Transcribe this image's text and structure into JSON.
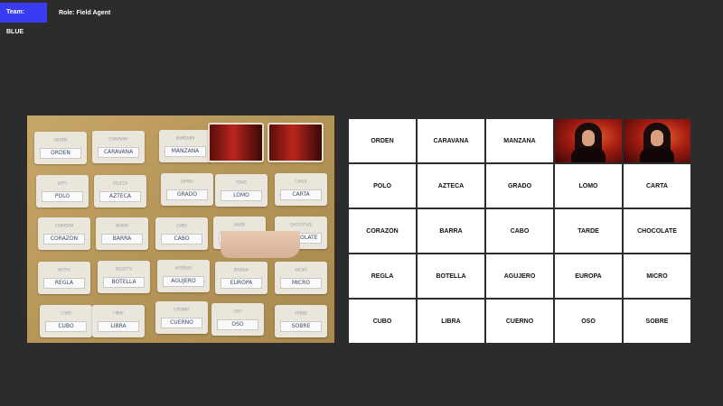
{
  "header": {
    "team": "Team: BLUE",
    "role": "Role: Field Agent"
  },
  "colors": {
    "team_accent": "#3a3af0",
    "agent_card": "#b8261c",
    "background": "#2c2c2c"
  },
  "board": {
    "cards": [
      {
        "word": "ORDEN",
        "revealed": false
      },
      {
        "word": "CARAVANA",
        "revealed": false
      },
      {
        "word": "MANZANA",
        "revealed": false
      },
      {
        "word": "",
        "revealed": true,
        "image": "agent-portrait"
      },
      {
        "word": "",
        "revealed": true,
        "image": "agent-portrait"
      },
      {
        "word": "POLO",
        "revealed": false
      },
      {
        "word": "AZTECA",
        "revealed": false
      },
      {
        "word": "GRADO",
        "revealed": false
      },
      {
        "word": "LOMO",
        "revealed": false
      },
      {
        "word": "CARTA",
        "revealed": false
      },
      {
        "word": "CORAZON",
        "revealed": false
      },
      {
        "word": "BARRA",
        "revealed": false
      },
      {
        "word": "CABO",
        "revealed": false
      },
      {
        "word": "TARDE",
        "revealed": false
      },
      {
        "word": "CHOCOLATE",
        "revealed": false
      },
      {
        "word": "REGLA",
        "revealed": false
      },
      {
        "word": "BOTELLA",
        "revealed": false
      },
      {
        "word": "AGUJERO",
        "revealed": false
      },
      {
        "word": "EUROPA",
        "revealed": false
      },
      {
        "word": "MICRO",
        "revealed": false
      },
      {
        "word": "CUBO",
        "revealed": false
      },
      {
        "word": "LIBRA",
        "revealed": false
      },
      {
        "word": "CUERNO",
        "revealed": false
      },
      {
        "word": "OSO",
        "revealed": false
      },
      {
        "word": "SOBRE",
        "revealed": false
      }
    ]
  },
  "camera": {
    "cards": [
      {
        "word": "ORDEN",
        "ghost": "ORDEN",
        "agent": false
      },
      {
        "word": "CARAVANA",
        "ghost": "CARAVANA",
        "agent": false
      },
      {
        "word": "MANZANA",
        "ghost": "MANZANA",
        "agent": false
      },
      {
        "word": "",
        "ghost": "",
        "agent": true
      },
      {
        "word": "",
        "ghost": "",
        "agent": true
      },
      {
        "word": "POLO",
        "ghost": "POLO",
        "agent": false
      },
      {
        "word": "AZTECA",
        "ghost": "AZTECA",
        "agent": false
      },
      {
        "word": "GRADO",
        "ghost": "GRADO",
        "agent": false
      },
      {
        "word": "LOMO",
        "ghost": "LOMO",
        "agent": false
      },
      {
        "word": "CARTA",
        "ghost": "CARTA",
        "agent": false
      },
      {
        "word": "CORAZON",
        "ghost": "CORAZON",
        "agent": false
      },
      {
        "word": "BARRA",
        "ghost": "BARRA",
        "agent": false
      },
      {
        "word": "CABO",
        "ghost": "CABO",
        "agent": false
      },
      {
        "word": "TARDE",
        "ghost": "TARDE",
        "agent": false
      },
      {
        "word": "CHOCOLATE",
        "ghost": "CHOCOLATE",
        "agent": false
      },
      {
        "word": "REGLA",
        "ghost": "REGLA",
        "agent": false
      },
      {
        "word": "BOTELLA",
        "ghost": "BOTELLA",
        "agent": false
      },
      {
        "word": "AGUJERO",
        "ghost": "AGUJERO",
        "agent": false
      },
      {
        "word": "EUROPA",
        "ghost": "EUROPA",
        "agent": false
      },
      {
        "word": "MICRO",
        "ghost": "MICRO",
        "agent": false
      },
      {
        "word": "CUBO",
        "ghost": "CUBO",
        "agent": false
      },
      {
        "word": "LIBRA",
        "ghost": "LIBRA",
        "agent": false
      },
      {
        "word": "CUERNO",
        "ghost": "CUERNO",
        "agent": false
      },
      {
        "word": "OSO",
        "ghost": "OSO",
        "agent": false
      },
      {
        "word": "SOBRE",
        "ghost": "SOBRE",
        "agent": false
      }
    ]
  }
}
